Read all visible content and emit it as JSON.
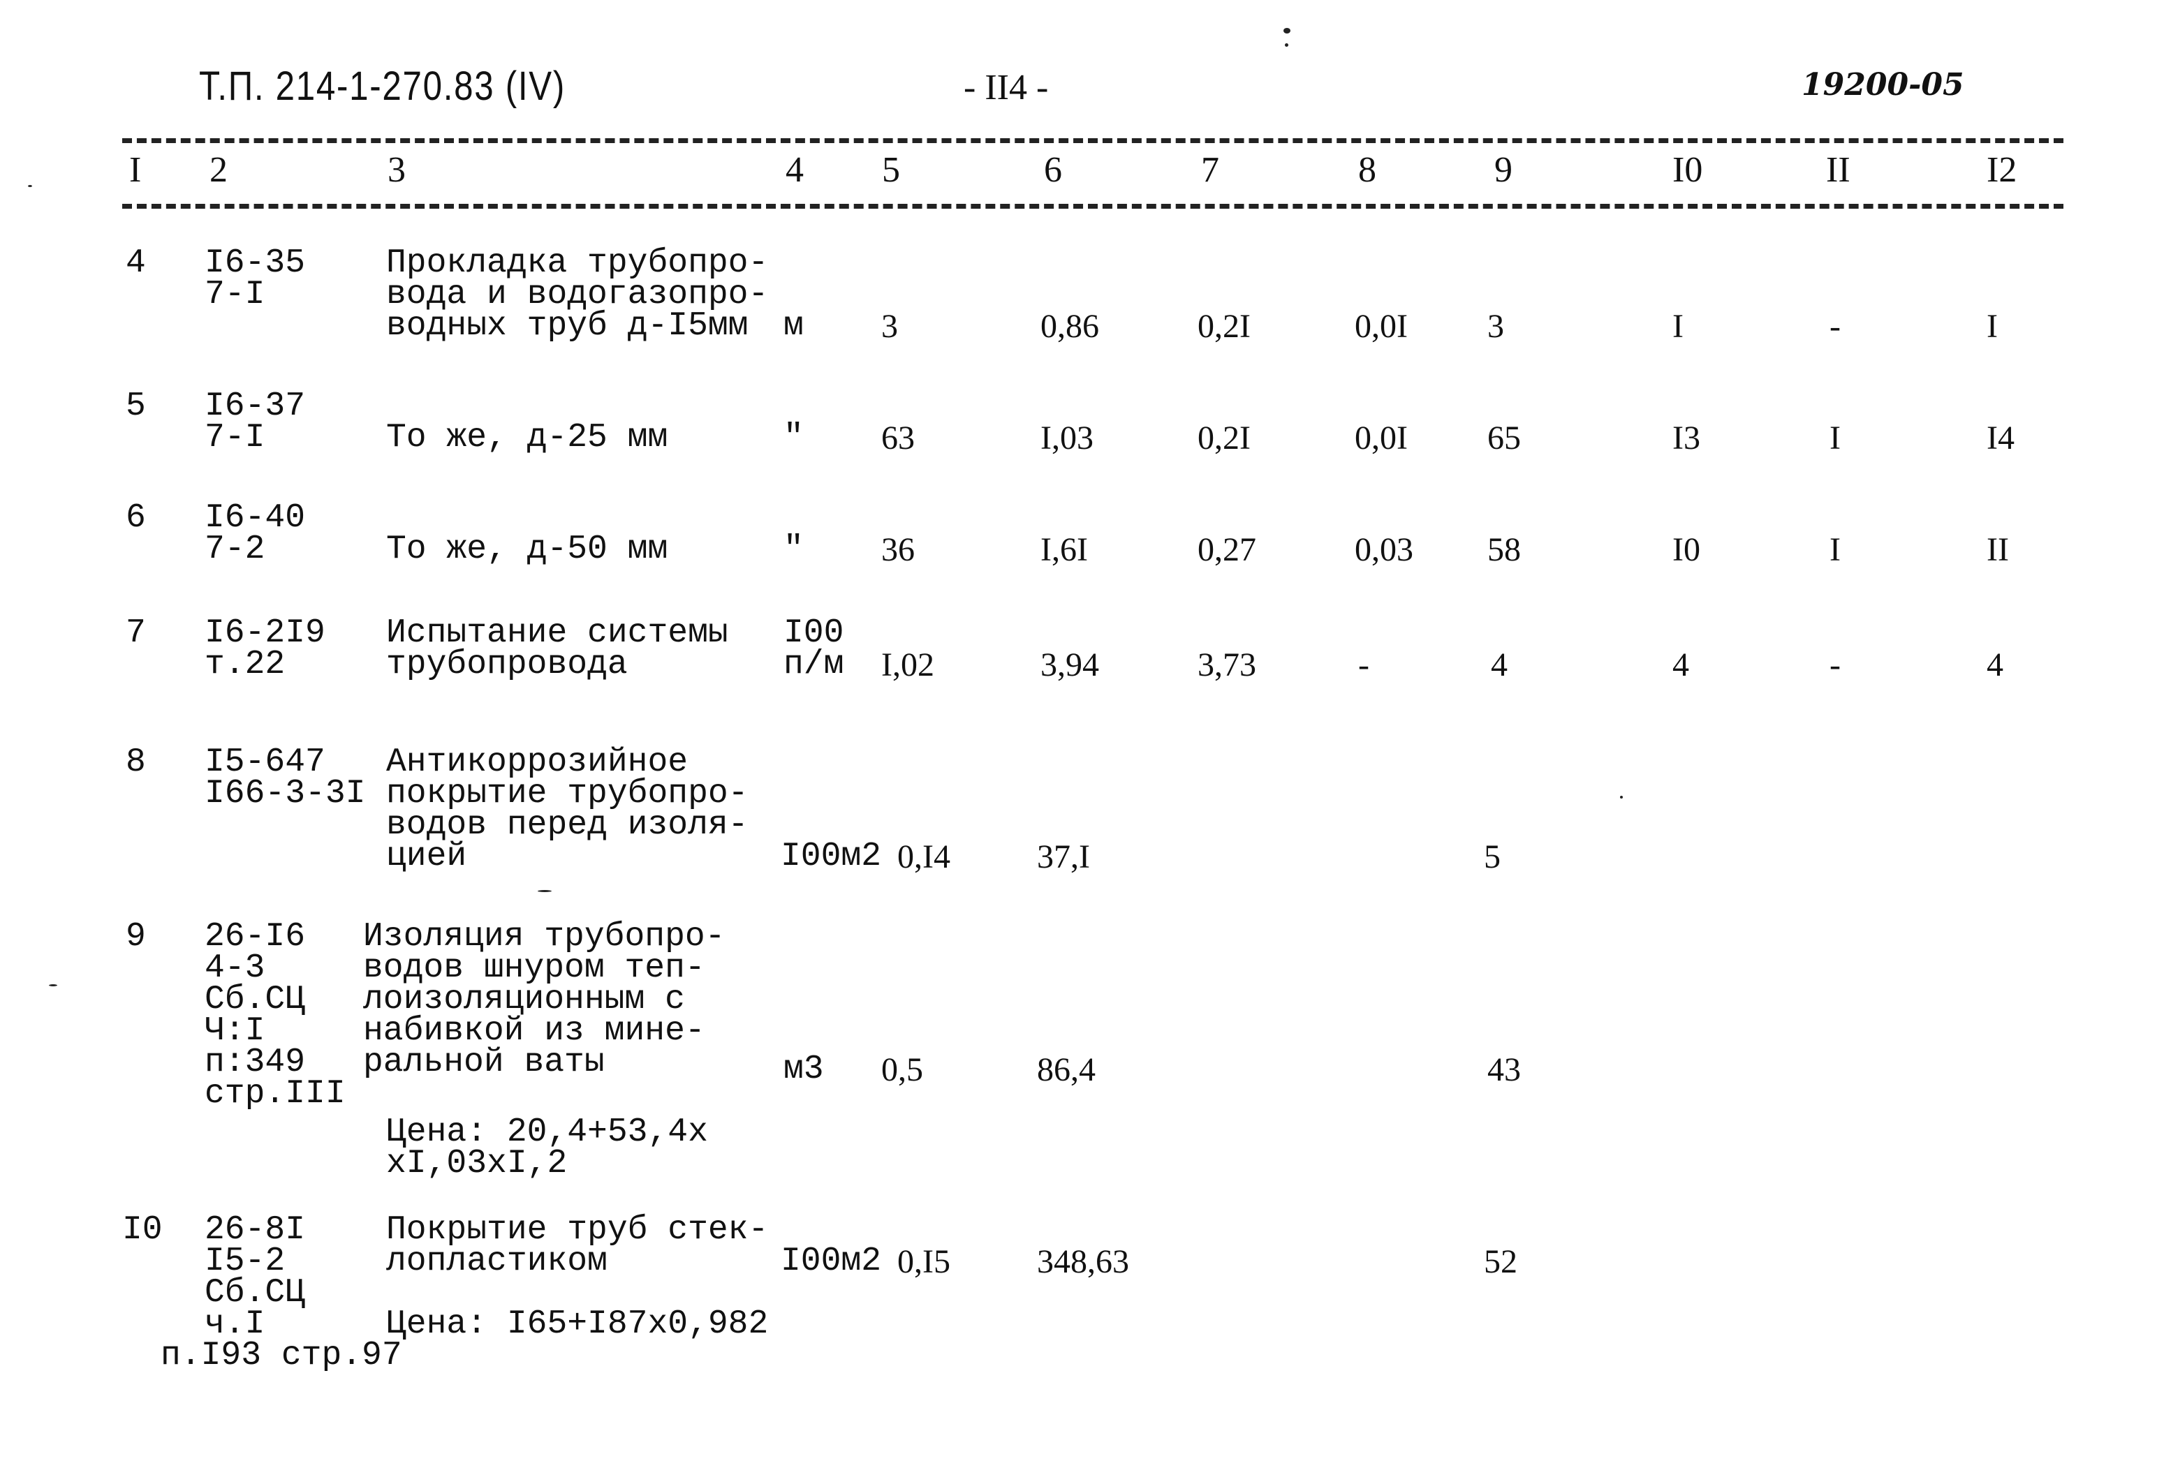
{
  "header": {
    "doc_code": "Т.П. 214-1-270.83 (IV)",
    "page_number": "- II4 -",
    "archive_number": "19200-05"
  },
  "columns": [
    "I",
    "2",
    "3",
    "4",
    "5",
    "6",
    "7",
    "8",
    "9",
    "I0",
    "II",
    "I2"
  ],
  "rows": [
    {
      "n": "4",
      "code": "I6-35\n7-I",
      "name": "Прокладка трубопро-\nвода и водогазопро-\nводных труб д-I5мм",
      "unit": "м",
      "c5": "3",
      "c6": "0,86",
      "c7": "0,2I",
      "c8": "0,0I",
      "c9": "3",
      "c10": "I",
      "c11": "-",
      "c12": "I"
    },
    {
      "n": "5",
      "code": "I6-37\n7-I",
      "name": "То же, д-25 мм",
      "unit": "\"",
      "c5": "63",
      "c6": "I,03",
      "c7": "0,2I",
      "c8": "0,0I",
      "c9": "65",
      "c10": "I3",
      "c11": "I",
      "c12": "I4"
    },
    {
      "n": "6",
      "code": "I6-40\n7-2",
      "name": "То же, д-50 мм",
      "unit": "\"",
      "c5": "36",
      "c6": "I,6I",
      "c7": "0,27",
      "c8": "0,03",
      "c9": "58",
      "c10": "I0",
      "c11": "I",
      "c12": "II"
    },
    {
      "n": "7",
      "code": "I6-2I9\nт.22",
      "name": "Испытание системы\nтрубопровода",
      "unit": "I00\nп/м",
      "c5": "I,02",
      "c6": "3,94",
      "c7": "3,73",
      "c8": "-",
      "c9": "4",
      "c10": "4",
      "c11": "-",
      "c12": "4"
    },
    {
      "n": "8",
      "code": "I5-647\nI66-3-3I",
      "name": "Антикоррозийное\nпокрытие трубопро-\nводов перед изоля-\nцией",
      "unit": "I00м2",
      "c5": "0,I4",
      "c6": "37,I",
      "c7": "",
      "c8": "",
      "c9": "5",
      "c10": "",
      "c11": "",
      "c12": ""
    },
    {
      "n": "9",
      "code": "26-I6\n4-3\nСб.СЦ\nЧ:I\nп:349\nстр.III",
      "name": "Изоляция трубопро-\nводов шнуром теп-\nлоизоляционным с\nнабивкой из мине-\nральной ваты",
      "note": "Цена: 20,4+53,4х\nхI,03хI,2",
      "unit": "м3",
      "c5": "0,5",
      "c6": "86,4",
      "c7": "",
      "c8": "",
      "c9": "43",
      "c10": "",
      "c11": "",
      "c12": ""
    },
    {
      "n": "I0",
      "code": "26-8I\nI5-2\nСб.СЦ\nч.I",
      "code_extra": "п.I93 стр.97",
      "name": "Покрытие труб стек-\nлопластиком",
      "note": "Цена: I65+I87х0,982",
      "unit": "I00м2",
      "c5": "0,I5",
      "c6": "348,63",
      "c7": "",
      "c8": "",
      "c9": "52",
      "c10": "",
      "c11": "",
      "c12": ""
    }
  ]
}
